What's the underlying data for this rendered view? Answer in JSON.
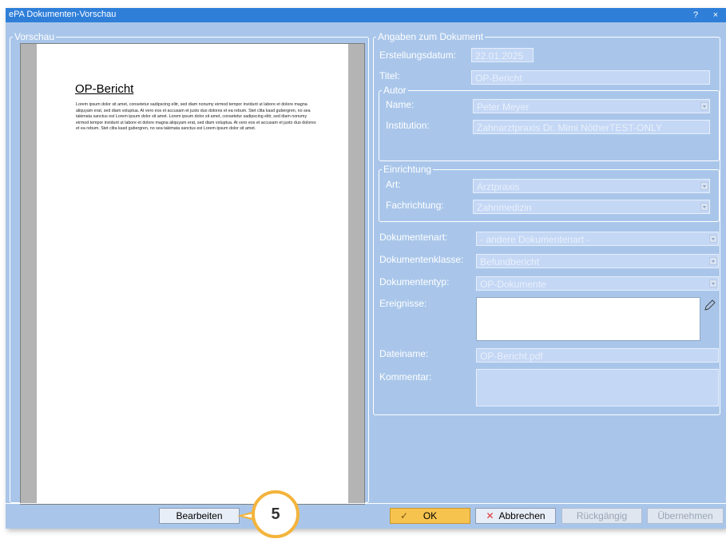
{
  "window": {
    "title": "ePA Dokumenten-Vorschau",
    "help_label": "?",
    "close_label": "×"
  },
  "preview": {
    "group_label": "Vorschau",
    "page_heading": "OP-Bericht",
    "page_body": "Lorem ipsum dolor sit amet, consetetur sadipscing elitr, sed diam nonumy eirmod tempor invidunt ut labore et dolore magna aliquyam erat, sed diam voluptua. At vero eos et accusam et justo duo dolores et ea rebum. Stet clita kasd gubergren, no sea takimata sanctus est Lorem ipsum dolor sit amet. Lorem ipsum dolor sit amet, consetetur sadipscing elitr, sed diam nonumy eirmod tempor invidunt ut labore et dolore magna aliquyam erat, sed diam voluptua. At vero eos et accusam et justo duo dolores et ea rebum. Stet clita kasd gubergren, no sea takimata sanctus est Lorem ipsum dolor sit amet."
  },
  "details": {
    "group_label": "Angaben zum Dokument",
    "creation_date": {
      "label": "Erstellungsdatum:",
      "value": "22.01.2025"
    },
    "title_field": {
      "label": "Titel:",
      "value": "OP-Bericht"
    },
    "author": {
      "group_label": "Autor",
      "name": {
        "label": "Name:",
        "value": "Peter Meyer"
      },
      "institution": {
        "label": "Institution:",
        "value": "Zahnarztpraxis Dr. Mimi NötherTEST-ONLY"
      }
    },
    "facility": {
      "group_label": "Einrichtung",
      "type": {
        "label": "Art:",
        "value": "Arztpraxis"
      },
      "specialty": {
        "label": "Fachrichtung:",
        "value": "Zahnmedizin"
      }
    },
    "doc_kind": {
      "label": "Dokumentenart:",
      "value": "- andere Dokumentenart -"
    },
    "doc_class": {
      "label": "Dokumentenklasse:",
      "value": "Befundbericht"
    },
    "doc_type": {
      "label": "Dokumententyp:",
      "value": "OP-Dokumente"
    },
    "events": {
      "label": "Ereignisse:",
      "value": ""
    },
    "filename": {
      "label": "Dateiname:",
      "value": "OP-Bericht.pdf"
    },
    "comment": {
      "label": "Kommentar:",
      "value": ""
    }
  },
  "buttons": {
    "edit": "Bearbeiten",
    "ok": "OK",
    "cancel": "Abbrechen",
    "undo": "Rückgängig",
    "apply": "Übernehmen"
  },
  "callout": {
    "number": "5"
  },
  "colors": {
    "dialog_bg": "#a9c6ea",
    "titlebar": "#2f7fd9",
    "field_bg": "#c4d7f5",
    "ok_button": "#f7c34f",
    "callout_ring": "#f3b43c"
  }
}
